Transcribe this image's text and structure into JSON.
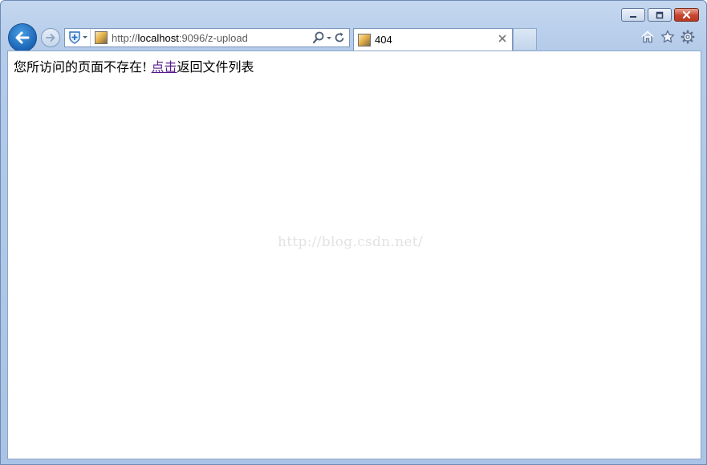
{
  "browser": {
    "address_bar": {
      "url_prefix": "http://",
      "url_host": "localhost",
      "url_rest": ":9096/z-upload"
    },
    "tabs": [
      {
        "title": "404",
        "active": true
      }
    ],
    "icons": {
      "back": "back-arrow-icon",
      "forward": "forward-arrow-icon",
      "compat": "compatibility-shield-icon",
      "search": "search-icon",
      "refresh": "refresh-icon",
      "home": "home-icon",
      "favorites": "star-icon",
      "tools": "gear-icon"
    },
    "colors": {
      "chrome": "#b4cbe9",
      "back_button": "#1a64b5",
      "close_button": "#c7452f",
      "visited_link": "#551a8b"
    }
  },
  "page": {
    "message_prefix": "您所访问的页面不存在! ",
    "link_text": "点击",
    "message_suffix": "返回文件列表",
    "watermark": "http://blog.csdn.net/"
  }
}
